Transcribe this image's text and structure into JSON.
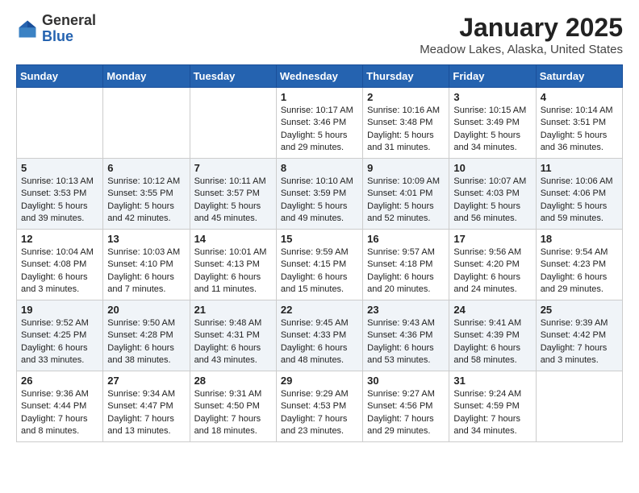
{
  "header": {
    "logo_general": "General",
    "logo_blue": "Blue",
    "title": "January 2025",
    "location": "Meadow Lakes, Alaska, United States"
  },
  "weekdays": [
    "Sunday",
    "Monday",
    "Tuesday",
    "Wednesday",
    "Thursday",
    "Friday",
    "Saturday"
  ],
  "weeks": [
    [
      {
        "day": "",
        "info": ""
      },
      {
        "day": "",
        "info": ""
      },
      {
        "day": "",
        "info": ""
      },
      {
        "day": "1",
        "info": "Sunrise: 10:17 AM\nSunset: 3:46 PM\nDaylight: 5 hours and 29 minutes."
      },
      {
        "day": "2",
        "info": "Sunrise: 10:16 AM\nSunset: 3:48 PM\nDaylight: 5 hours and 31 minutes."
      },
      {
        "day": "3",
        "info": "Sunrise: 10:15 AM\nSunset: 3:49 PM\nDaylight: 5 hours and 34 minutes."
      },
      {
        "day": "4",
        "info": "Sunrise: 10:14 AM\nSunset: 3:51 PM\nDaylight: 5 hours and 36 minutes."
      }
    ],
    [
      {
        "day": "5",
        "info": "Sunrise: 10:13 AM\nSunset: 3:53 PM\nDaylight: 5 hours and 39 minutes."
      },
      {
        "day": "6",
        "info": "Sunrise: 10:12 AM\nSunset: 3:55 PM\nDaylight: 5 hours and 42 minutes."
      },
      {
        "day": "7",
        "info": "Sunrise: 10:11 AM\nSunset: 3:57 PM\nDaylight: 5 hours and 45 minutes."
      },
      {
        "day": "8",
        "info": "Sunrise: 10:10 AM\nSunset: 3:59 PM\nDaylight: 5 hours and 49 minutes."
      },
      {
        "day": "9",
        "info": "Sunrise: 10:09 AM\nSunset: 4:01 PM\nDaylight: 5 hours and 52 minutes."
      },
      {
        "day": "10",
        "info": "Sunrise: 10:07 AM\nSunset: 4:03 PM\nDaylight: 5 hours and 56 minutes."
      },
      {
        "day": "11",
        "info": "Sunrise: 10:06 AM\nSunset: 4:06 PM\nDaylight: 5 hours and 59 minutes."
      }
    ],
    [
      {
        "day": "12",
        "info": "Sunrise: 10:04 AM\nSunset: 4:08 PM\nDaylight: 6 hours and 3 minutes."
      },
      {
        "day": "13",
        "info": "Sunrise: 10:03 AM\nSunset: 4:10 PM\nDaylight: 6 hours and 7 minutes."
      },
      {
        "day": "14",
        "info": "Sunrise: 10:01 AM\nSunset: 4:13 PM\nDaylight: 6 hours and 11 minutes."
      },
      {
        "day": "15",
        "info": "Sunrise: 9:59 AM\nSunset: 4:15 PM\nDaylight: 6 hours and 15 minutes."
      },
      {
        "day": "16",
        "info": "Sunrise: 9:57 AM\nSunset: 4:18 PM\nDaylight: 6 hours and 20 minutes."
      },
      {
        "day": "17",
        "info": "Sunrise: 9:56 AM\nSunset: 4:20 PM\nDaylight: 6 hours and 24 minutes."
      },
      {
        "day": "18",
        "info": "Sunrise: 9:54 AM\nSunset: 4:23 PM\nDaylight: 6 hours and 29 minutes."
      }
    ],
    [
      {
        "day": "19",
        "info": "Sunrise: 9:52 AM\nSunset: 4:25 PM\nDaylight: 6 hours and 33 minutes."
      },
      {
        "day": "20",
        "info": "Sunrise: 9:50 AM\nSunset: 4:28 PM\nDaylight: 6 hours and 38 minutes."
      },
      {
        "day": "21",
        "info": "Sunrise: 9:48 AM\nSunset: 4:31 PM\nDaylight: 6 hours and 43 minutes."
      },
      {
        "day": "22",
        "info": "Sunrise: 9:45 AM\nSunset: 4:33 PM\nDaylight: 6 hours and 48 minutes."
      },
      {
        "day": "23",
        "info": "Sunrise: 9:43 AM\nSunset: 4:36 PM\nDaylight: 6 hours and 53 minutes."
      },
      {
        "day": "24",
        "info": "Sunrise: 9:41 AM\nSunset: 4:39 PM\nDaylight: 6 hours and 58 minutes."
      },
      {
        "day": "25",
        "info": "Sunrise: 9:39 AM\nSunset: 4:42 PM\nDaylight: 7 hours and 3 minutes."
      }
    ],
    [
      {
        "day": "26",
        "info": "Sunrise: 9:36 AM\nSunset: 4:44 PM\nDaylight: 7 hours and 8 minutes."
      },
      {
        "day": "27",
        "info": "Sunrise: 9:34 AM\nSunset: 4:47 PM\nDaylight: 7 hours and 13 minutes."
      },
      {
        "day": "28",
        "info": "Sunrise: 9:31 AM\nSunset: 4:50 PM\nDaylight: 7 hours and 18 minutes."
      },
      {
        "day": "29",
        "info": "Sunrise: 9:29 AM\nSunset: 4:53 PM\nDaylight: 7 hours and 23 minutes."
      },
      {
        "day": "30",
        "info": "Sunrise: 9:27 AM\nSunset: 4:56 PM\nDaylight: 7 hours and 29 minutes."
      },
      {
        "day": "31",
        "info": "Sunrise: 9:24 AM\nSunset: 4:59 PM\nDaylight: 7 hours and 34 minutes."
      },
      {
        "day": "",
        "info": ""
      }
    ]
  ]
}
